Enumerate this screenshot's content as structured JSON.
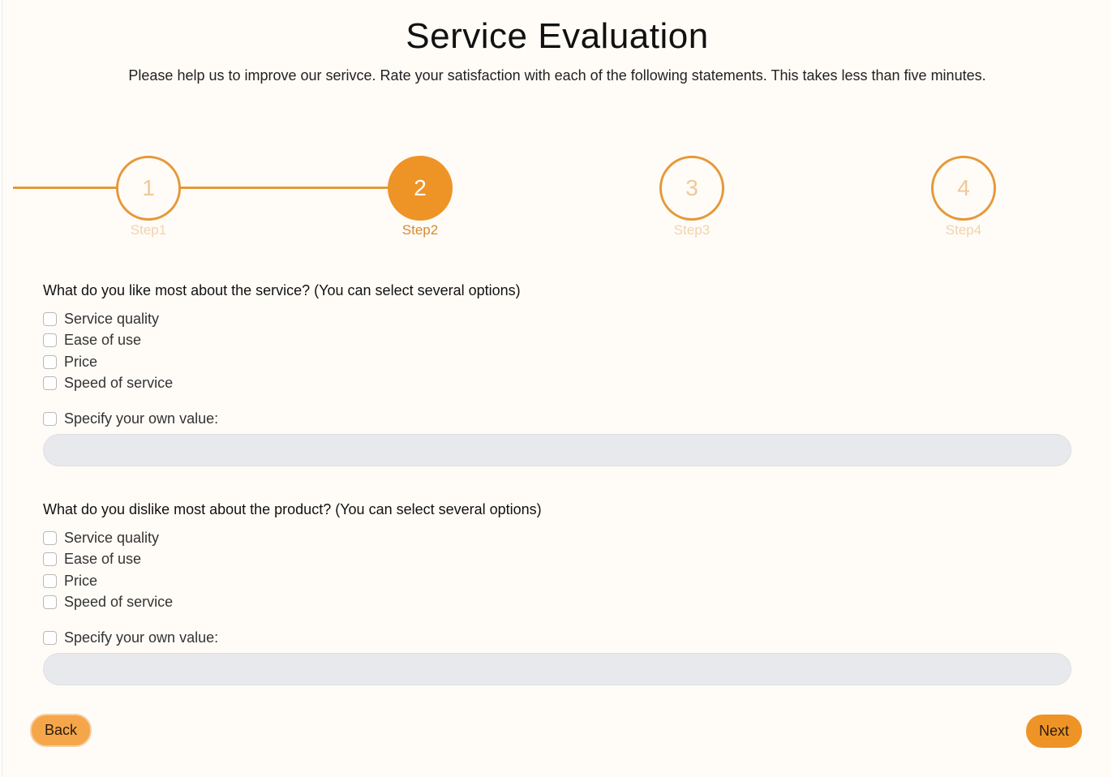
{
  "header": {
    "title": "Service Evaluation",
    "subtitle": "Please help us to improve our serivce. Rate your satisfaction with each of the following statements. This takes less than five minutes."
  },
  "stepper": {
    "current_step": 2,
    "steps": [
      {
        "number": "1",
        "label": "Step1"
      },
      {
        "number": "2",
        "label": "Step2"
      },
      {
        "number": "3",
        "label": "Step3"
      },
      {
        "number": "4",
        "label": "Step4"
      }
    ]
  },
  "questions": [
    {
      "title": "What do you like most about the service? (You can select several options)",
      "options": [
        "Service quality",
        "Ease of use",
        "Price",
        "Speed of service"
      ],
      "own_value_label": "Specify your own value:",
      "own_value": ""
    },
    {
      "title": "What do you dislike most about the product? (You can select several options)",
      "options": [
        "Service quality",
        "Ease of use",
        "Price",
        "Speed of service"
      ],
      "own_value_label": "Specify your own value:",
      "own_value": ""
    }
  ],
  "buttons": {
    "back_label": "Back",
    "next_label": "Next"
  },
  "colors": {
    "accent": "#ee9427",
    "background": "#fffcf7",
    "input_bg": "#e8e9ec"
  }
}
